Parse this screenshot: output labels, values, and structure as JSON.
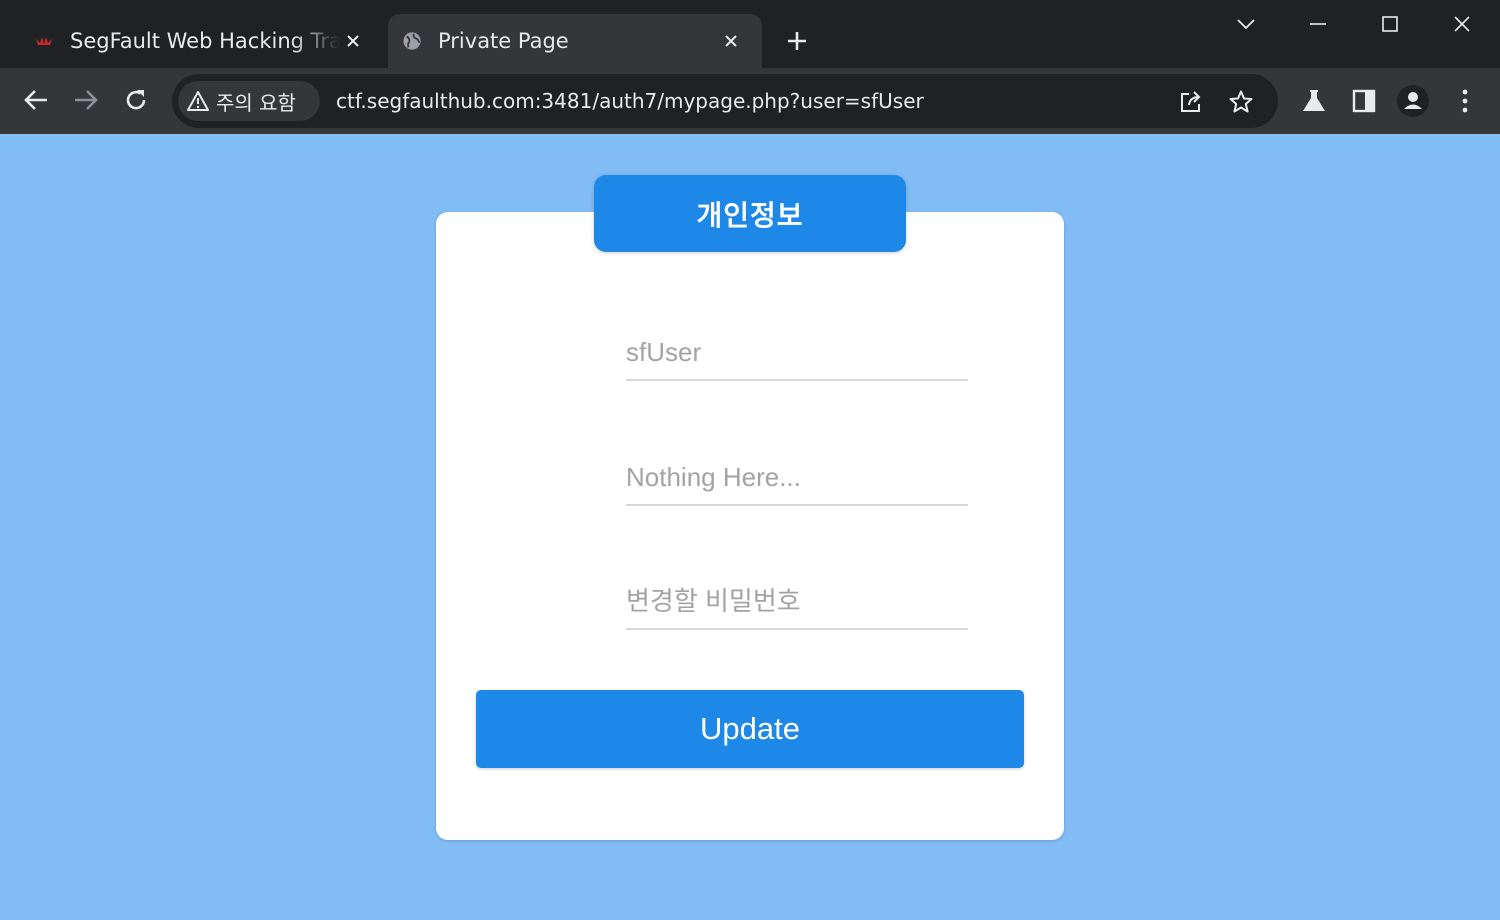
{
  "browser": {
    "tabs": [
      {
        "title": "SegFault Web Hacking Trai",
        "active": false
      },
      {
        "title": "Private Page",
        "active": true
      }
    ],
    "address_bar": {
      "security_chip": "주의 요함",
      "url": "ctf.segfaulthub.com:3481/auth7/mypage.php?user=sfUser"
    }
  },
  "page": {
    "header": "개인정보",
    "fields": {
      "username_placeholder": "sfUser",
      "info_placeholder": "Nothing Here...",
      "new_password_placeholder": "변경할 비밀번호"
    },
    "update_label": "Update"
  },
  "colors": {
    "background": "#82bcf5",
    "accent": "#1e88e8",
    "card": "#ffffff"
  }
}
